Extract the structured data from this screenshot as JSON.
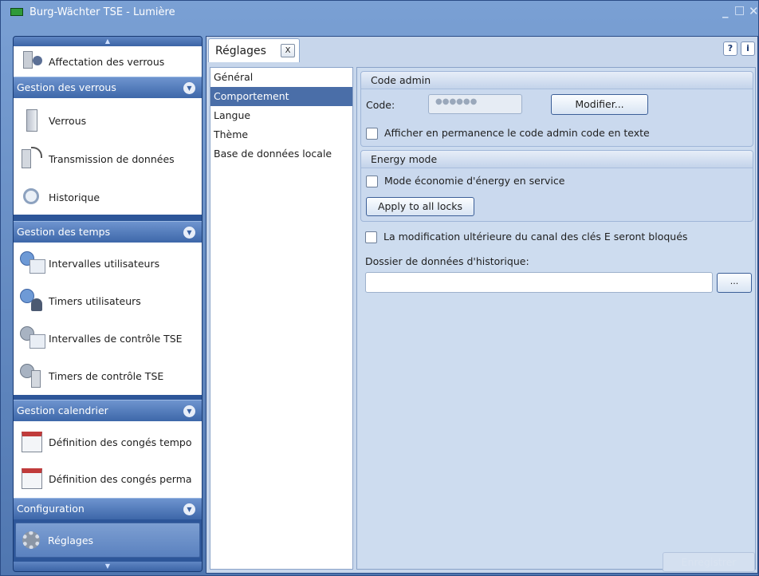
{
  "window": {
    "title": "Burg-Wächter TSE - Lumière",
    "minimize": "_",
    "maximize": "□",
    "close": "✕"
  },
  "sidebar": {
    "scroll_up": "▲",
    "scroll_down": "▼",
    "collapse_glyph": "▼",
    "top_item": "Affectation des verrous",
    "groups": [
      {
        "title": "Gestion des verrous",
        "items": [
          "Verrous",
          "Transmission de données",
          "Historique"
        ]
      },
      {
        "title": "Gestion des temps",
        "items": [
          "Intervalles utilisateurs",
          "Timers utilisateurs",
          "Intervalles de contrôle TSE",
          "Timers de contrôle TSE"
        ]
      },
      {
        "title": "Gestion calendrier",
        "items": [
          "Définition des congés tempo",
          "Définition des congés perma"
        ]
      },
      {
        "title": "Configuration",
        "items": [
          "Réglages"
        ]
      }
    ]
  },
  "tab": {
    "label": "Réglages",
    "close": "X"
  },
  "help": {
    "help": "?",
    "info": "i"
  },
  "categories": [
    "Général",
    "Comportement",
    "Langue",
    "Thème",
    "Base de données locale"
  ],
  "settings": {
    "code_admin": {
      "title": "Code admin",
      "code_label": "Code:",
      "code_value": "●●●●●●",
      "modify": "Modifier...",
      "show_plain": "Afficher en permanence le code admin code en texte"
    },
    "energy": {
      "title": "Energy mode",
      "saving": "Mode économie d'énergy en service",
      "apply": "Apply to all locks"
    },
    "lock_canal": "La modification ultérieure du canal des clés E seront bloqués",
    "history_folder_label": "Dossier de données d'historique:",
    "browse": "...",
    "save": "Enregistrer"
  },
  "colors": {
    "accent": "#2d5699",
    "selection": "#4a6ea8",
    "panel": "#c7d6eb"
  }
}
